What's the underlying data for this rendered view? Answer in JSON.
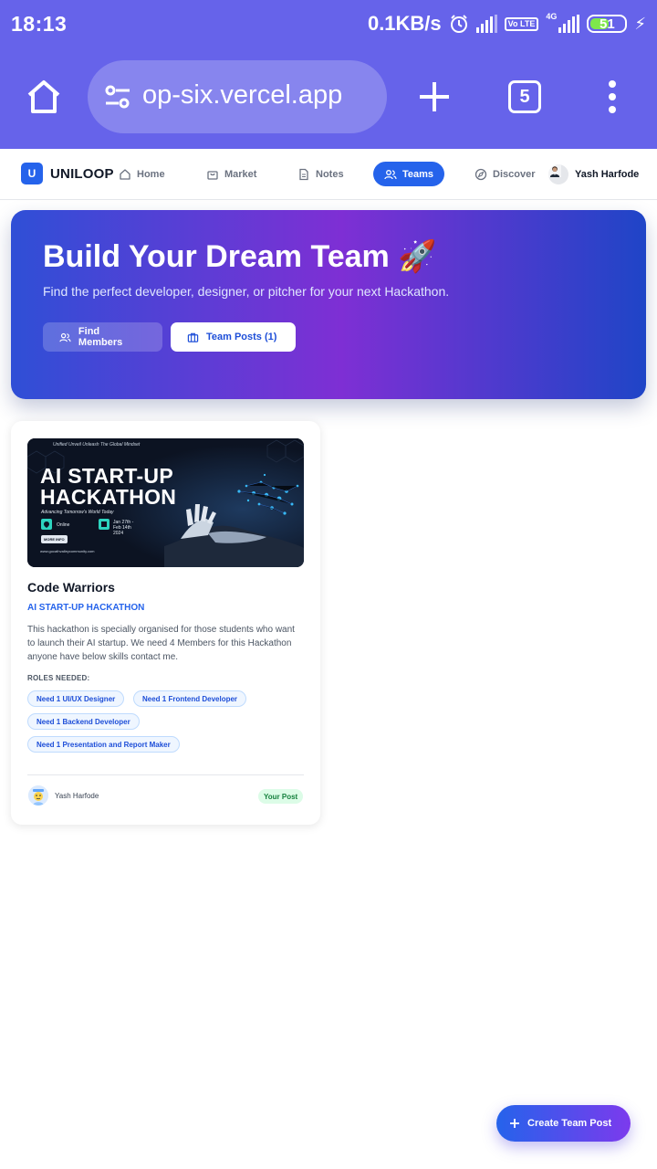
{
  "status_bar": {
    "time": "18:13",
    "network_speed": "0.1KB/s",
    "lte_badge": "Vo LTE",
    "net_type": "4G",
    "battery": "51"
  },
  "browser": {
    "url": "op-six.vercel.app",
    "tab_count": "5"
  },
  "nav": {
    "brand_logo": "U",
    "brand_name": "UNILOOP",
    "items": [
      {
        "label": "Home",
        "icon": "home-icon"
      },
      {
        "label": "Market",
        "icon": "bag-icon"
      },
      {
        "label": "Notes",
        "icon": "document-icon"
      },
      {
        "label": "Teams",
        "icon": "users-icon",
        "active": true
      },
      {
        "label": "Discover",
        "icon": "compass-icon"
      }
    ],
    "user_name": "Yash Harfode"
  },
  "hero": {
    "title": "Build Your Dream Team 🚀",
    "subtitle": "Find the perfect developer, designer, or pitcher for your next Hackathon.",
    "find_members_label": "Find Members",
    "team_posts_label": "Team Posts (1)"
  },
  "post": {
    "poster": {
      "tagline_top": "Unified Unveil Unleash The Global Mindset",
      "title_line1": "AI START-UP",
      "title_line2": "HACKATHON",
      "subtitle": "Advancing Tomorrow's World Today",
      "mode": "Online",
      "date": "Jan 27th - Feb 14th 2024",
      "more_info": "MORE INFO",
      "website": "www.gocathvalleycommunity.com"
    },
    "team_name": "Code Warriors",
    "event_name": "AI START-UP HACKATHON",
    "description": "This hackathon is specially organised for those students who want to launch their AI startup. We need 4 Members for this Hackathon anyone have below skills contact me.",
    "roles_label": "ROLES NEEDED:",
    "roles": [
      "Need 1 UI/UX Designer",
      "Need 1 Frontend Developer",
      "Need 1 Backend Developer",
      "Need 1 Presentation and Report Maker"
    ],
    "author": "Yash Harfode",
    "ownership_badge": "Your Post"
  },
  "fab": {
    "label": "Create Team Post"
  },
  "colors": {
    "browser_bar": "#6663ea",
    "primary": "#2563eb",
    "hero_purple": "#7e2fd4",
    "badge_green_bg": "#dcfce7",
    "badge_green_text": "#15803d"
  }
}
